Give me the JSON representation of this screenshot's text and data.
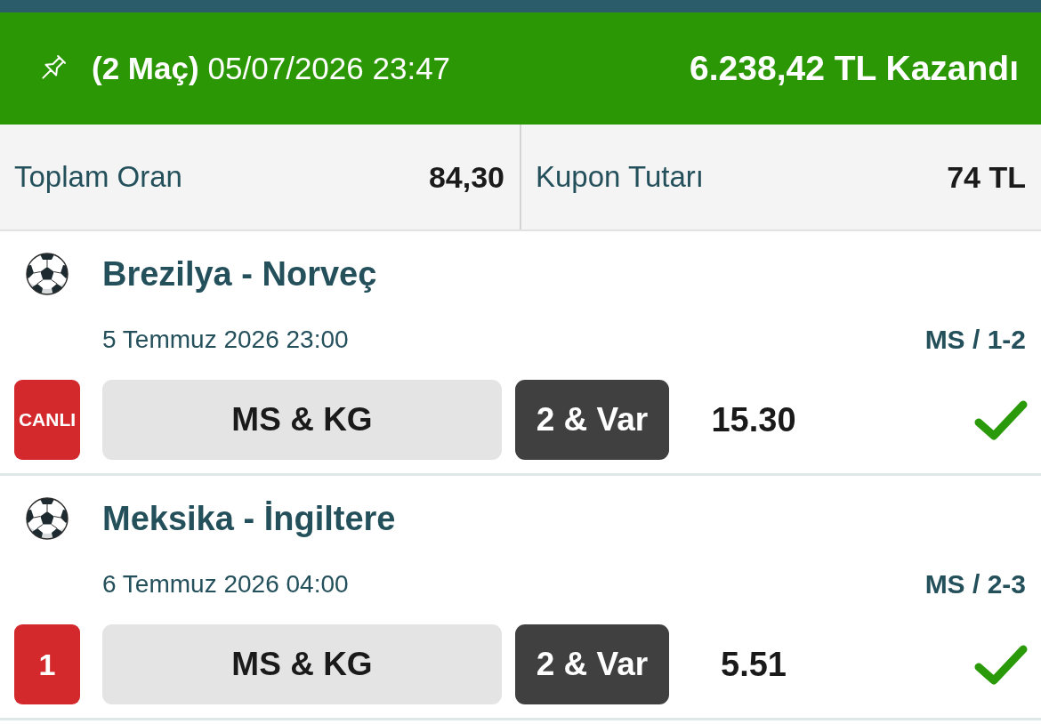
{
  "header": {
    "won": true,
    "match_count": "(2 Maç)",
    "date": "05/07/2026 23:47",
    "winnings": "6.238,42 TL Kazandı"
  },
  "summary": [
    {
      "label": "Toplam Oran",
      "value": "84,30"
    },
    {
      "label": "Kupon Tutarı",
      "value": "74 TL"
    }
  ],
  "matches": [
    {
      "teams": "Brezilya - Norveç",
      "date": "5 Temmuz 2026 23:00",
      "result": "MS / 1-2",
      "badge": {
        "kind": "live",
        "text": "CANLI"
      },
      "market": "MS & KG",
      "pick": "2 & Var",
      "odds": "15.30",
      "won": true
    },
    {
      "teams": "Meksika - İngiltere",
      "date": "6 Temmuz 2026 04:00",
      "result": "MS / 2-3",
      "badge": {
        "kind": "number",
        "text": "1"
      },
      "market": "MS & KG",
      "pick": "2 & Var",
      "odds": "5.51",
      "won": true
    }
  ]
}
